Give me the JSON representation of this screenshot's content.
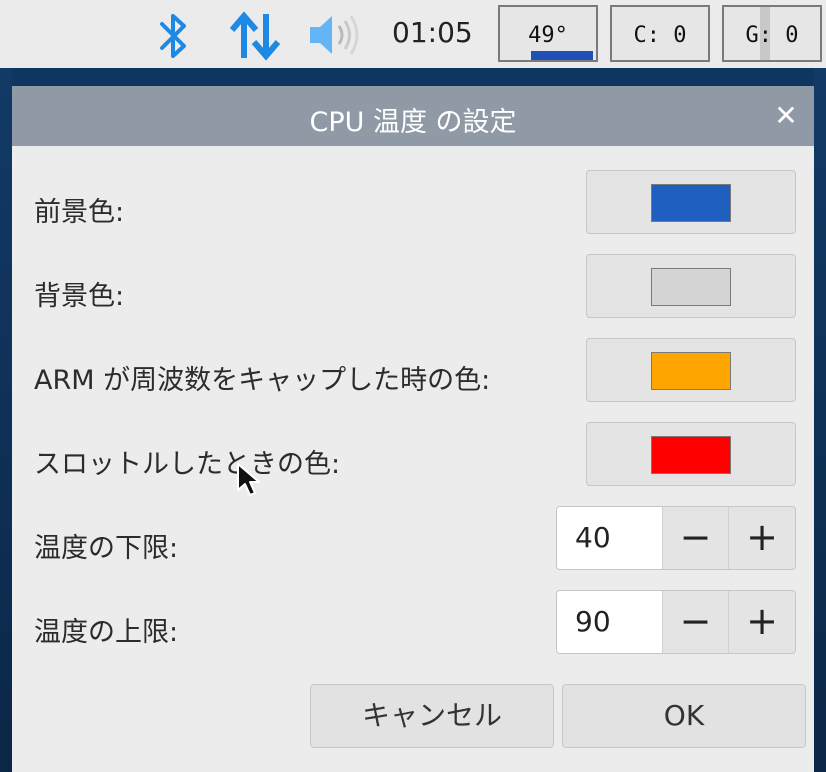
{
  "taskbar": {
    "clock": "01:05",
    "icons": [
      "bluetooth-icon",
      "network-updown-icon",
      "volume-icon"
    ],
    "temp_monitor": "49°",
    "cpu_monitor": "C: 0",
    "gpu_monitor": "G: 0",
    "accent_color": "#1e88e5"
  },
  "dialog": {
    "title": "CPU 温度 の設定",
    "rows": [
      {
        "label": "前景色:",
        "type": "color",
        "color": "#1f5fbf"
      },
      {
        "label": "背景色:",
        "type": "color",
        "color": "#d4d4d4"
      },
      {
        "label": "ARM が周波数をキャップした時の色:",
        "type": "color",
        "color": "#ffa500"
      },
      {
        "label": "スロットルしたときの色:",
        "type": "color",
        "color": "#ff0000"
      },
      {
        "label": "温度の下限:",
        "type": "spin",
        "value": "40"
      },
      {
        "label": "温度の上限:",
        "type": "spin",
        "value": "90"
      }
    ],
    "buttons": {
      "cancel": "キャンセル",
      "ok": "OK"
    }
  }
}
